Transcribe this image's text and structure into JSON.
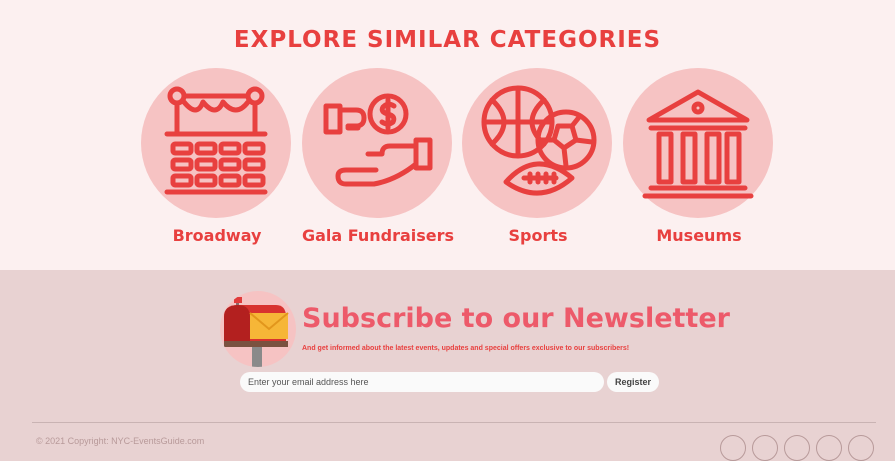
{
  "section_heading": "Explore Similar Categories",
  "categories": [
    {
      "label": "Broadway",
      "icon": "theater-stage-icon"
    },
    {
      "label": "Gala Fundraisers",
      "icon": "donation-hand-icon"
    },
    {
      "label": "Sports",
      "icon": "sports-balls-icon"
    },
    {
      "label": "Museums",
      "icon": "museum-building-icon"
    }
  ],
  "newsletter": {
    "title": "Subscribe to our Newsletter",
    "subtitle": "And get informed about the latest events, updates and special offers exclusive to our subscribers!",
    "email_placeholder": "Enter your email address here",
    "register_label": "Register",
    "icon": "mailbox-icon"
  },
  "footer": {
    "copyright": "© 2021 Copyright: NYC-EventsGuide.com",
    "social_icons": [
      "facebook-icon",
      "twitter-icon",
      "instagram-icon",
      "youtube-icon",
      "linkedin-icon"
    ]
  },
  "colors": {
    "accent": "#e8403f",
    "circle_fill": "#f6c3c3",
    "top_bg": "#fcf0f0",
    "bottom_bg": "#e8d2d2",
    "newsletter_title": "#ed5a6a"
  }
}
